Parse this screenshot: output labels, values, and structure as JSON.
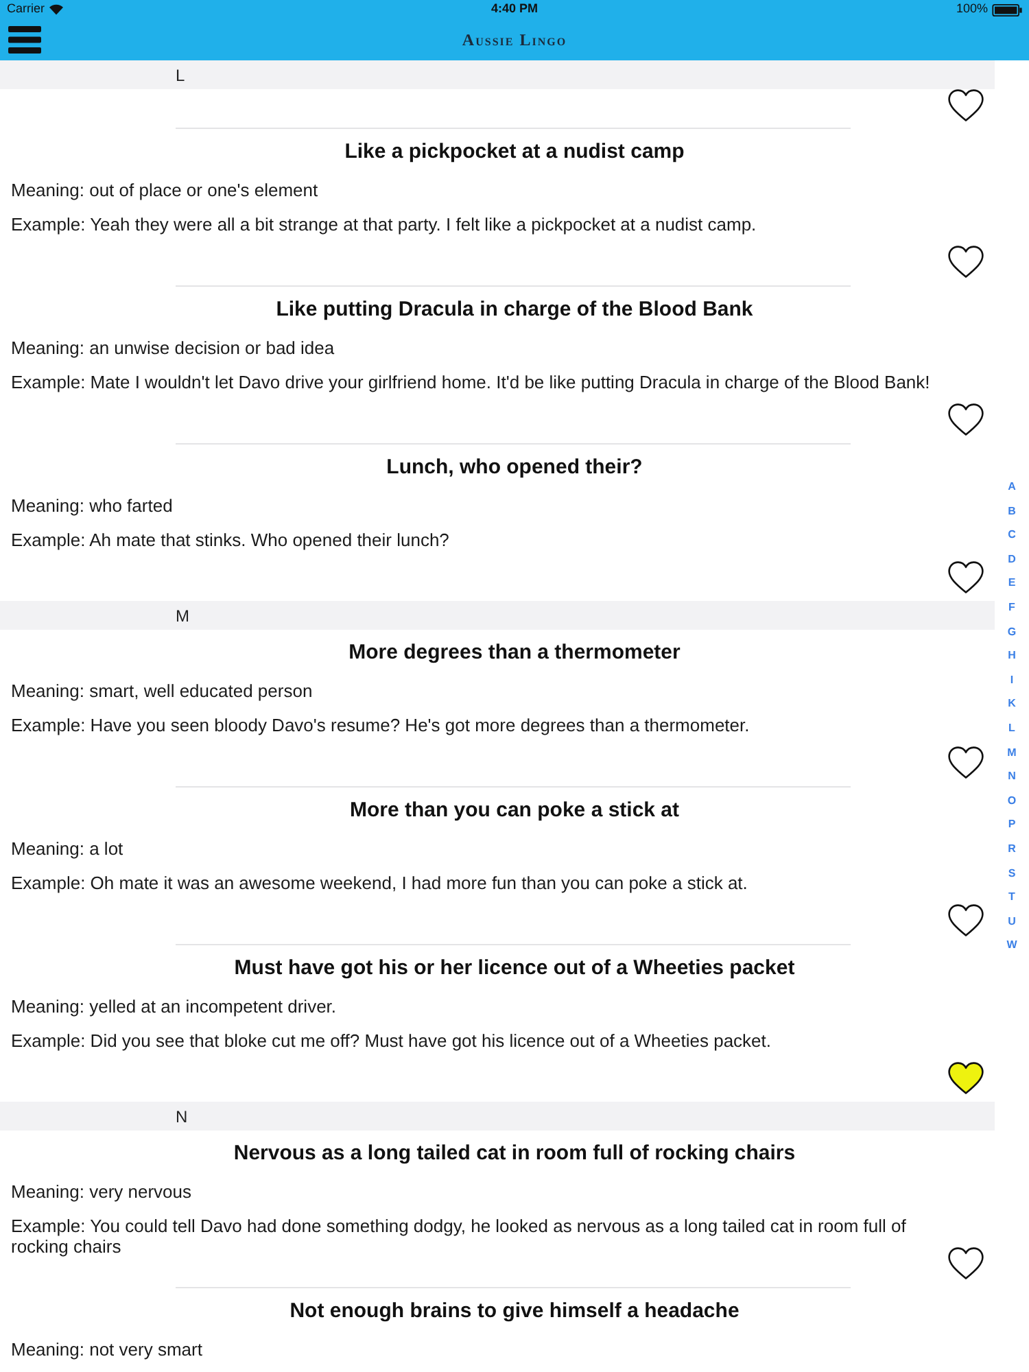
{
  "status_bar": {
    "carrier": "Carrier",
    "time": "4:40 PM",
    "battery": "100%"
  },
  "nav_bar": {
    "title": "Aussie Lingo"
  },
  "sections": [
    {
      "letter": "L",
      "entries": [
        {
          "kind": "cut_off",
          "favorite": false
        },
        {
          "kind": "entry",
          "title": "Like a pickpocket at a nudist camp",
          "meaning": "Meaning: out of place or one's element",
          "example": "Example: Yeah they were all a bit strange at that party. I felt like a pickpocket at a nudist camp.",
          "favorite": false
        },
        {
          "kind": "entry",
          "title": "Like putting Dracula in charge of the Blood Bank",
          "meaning": "Meaning: an unwise decision or bad idea",
          "example": "Example: Mate I wouldn't let Davo drive your girlfriend home. It'd be like putting Dracula in charge of the Blood Bank!",
          "favorite": false
        },
        {
          "kind": "entry",
          "title": "Lunch, who opened their?",
          "meaning": "Meaning: who farted",
          "example": "Example: Ah mate that stinks. Who opened their lunch?",
          "favorite": false
        }
      ]
    },
    {
      "letter": "M",
      "entries": [
        {
          "kind": "entry",
          "title": "More degrees than a thermometer",
          "meaning": "Meaning: smart, well educated person",
          "example": "Example: Have you seen bloody Davo's resume? He's got more degrees than a thermometer.",
          "favorite": false
        },
        {
          "kind": "entry",
          "title": "More than you can poke a stick at",
          "meaning": "Meaning: a lot",
          "example": "Example: Oh mate it was an awesome weekend, I had more fun than you can poke a stick at.",
          "favorite": false
        },
        {
          "kind": "entry",
          "title": "Must have got his or her licence out of a Wheeties packet",
          "meaning": "Meaning: yelled at an incompetent driver.",
          "example": "Example: Did you see that bloke cut me off? Must have got his licence out of a Wheeties packet.",
          "favorite": true
        }
      ]
    },
    {
      "letter": "N",
      "entries": [
        {
          "kind": "entry",
          "title": "Nervous as a long tailed cat in room full of rocking chairs",
          "meaning": "Meaning: very nervous",
          "example": "Example: You could tell Davo had done something dodgy, he looked as nervous as a long tailed cat in room full of rocking chairs",
          "favorite": false
        },
        {
          "kind": "entry",
          "title": "Not enough brains to give himself a headache",
          "meaning": "Meaning: not very smart"
        }
      ]
    }
  ],
  "index": [
    "A",
    "B",
    "C",
    "D",
    "E",
    "F",
    "G",
    "H",
    "I",
    "K",
    "L",
    "M",
    "N",
    "O",
    "P",
    "R",
    "S",
    "T",
    "U",
    "W"
  ]
}
